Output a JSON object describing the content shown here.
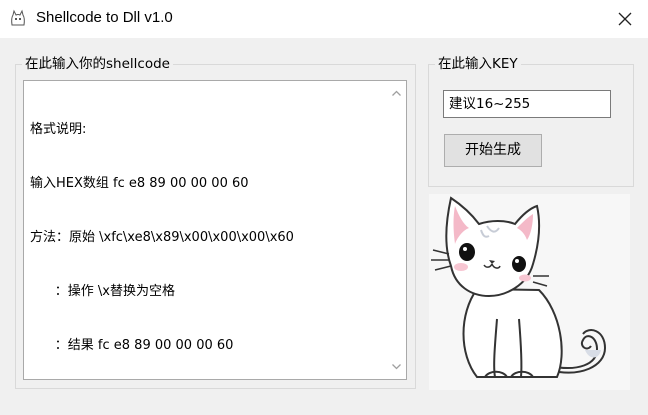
{
  "window": {
    "title": "Shellcode to Dll v1.0",
    "icons": {
      "app": "cat-app-icon",
      "close": "close-icon"
    }
  },
  "shellcode_group": {
    "legend": "在此输入你的shellcode",
    "memo_lines": [
      "格式说明:",
      "输入HEX数组 fc e8 89 00 00 00 60",
      "方法：原始 \\xfc\\xe8\\x89\\x00\\x00\\x00\\x60",
      "      ：操作 \\x替换为空格",
      "      ：结果 fc e8 89 00 00 00 60"
    ]
  },
  "key_group": {
    "legend": "在此输入KEY",
    "input_value": "建议16~255",
    "generate_label": "开始生成"
  },
  "illustration": {
    "icon": "cat-illustration"
  }
}
